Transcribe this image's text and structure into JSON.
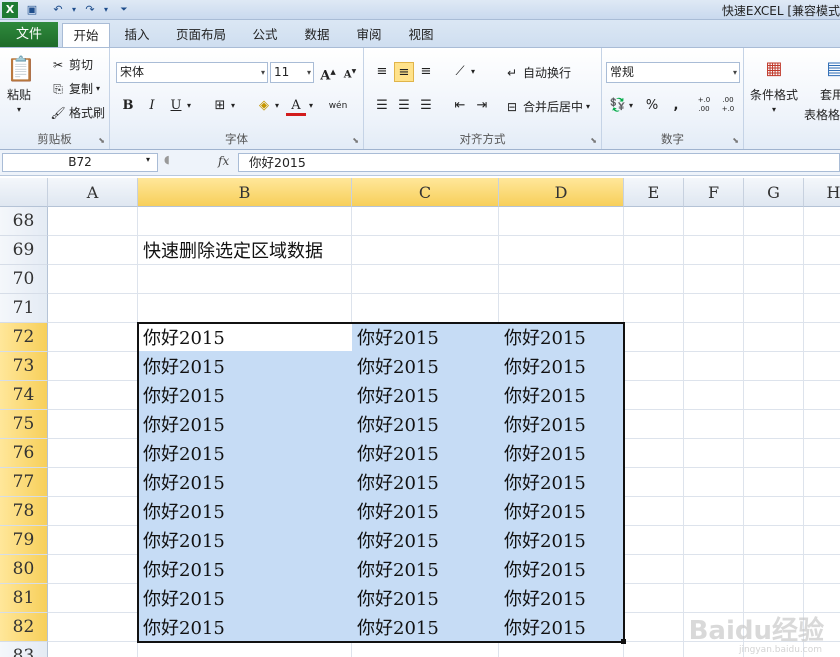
{
  "window": {
    "title": "快速EXCEL  [兼容模式"
  },
  "tabs": {
    "file": "文件",
    "items": [
      "开始",
      "插入",
      "页面布局",
      "公式",
      "数据",
      "审阅",
      "视图"
    ],
    "active": 0
  },
  "ribbon": {
    "clipboard": {
      "label": "剪贴板",
      "paste": "粘贴",
      "cut": "剪切",
      "copy": "复制",
      "format_painter": "格式刷"
    },
    "font": {
      "label": "字体",
      "font_name": "宋体",
      "font_size": "11",
      "bold": "B",
      "italic": "I",
      "underline": "U",
      "grow": "A",
      "shrink": "A",
      "color": "A",
      "phonetic": "wén"
    },
    "alignment": {
      "label": "对齐方式",
      "wrap_text": "自动换行",
      "merge_center": "合并后居中"
    },
    "number": {
      "label": "数字",
      "format": "常规",
      "percent": "%",
      "comma": ",",
      "inc_decimal": "+.0 .00",
      "dec_decimal": ".00 +.0"
    },
    "styles": {
      "conditional": "条件格式",
      "table_format_1": "套用",
      "table_format_2": "表格格"
    }
  },
  "formula_bar": {
    "name_box": "B72",
    "fx": "fx",
    "content": "你好2015"
  },
  "grid": {
    "columns": [
      "A",
      "B",
      "C",
      "D",
      "E",
      "F",
      "G",
      "H"
    ],
    "selected_columns": [
      "B",
      "C",
      "D"
    ],
    "rows": [
      "68",
      "69",
      "70",
      "71",
      "72",
      "73",
      "74",
      "75",
      "76",
      "77",
      "78",
      "79",
      "80",
      "81",
      "82",
      "83"
    ],
    "selected_rows": [
      "72",
      "73",
      "74",
      "75",
      "76",
      "77",
      "78",
      "79",
      "80",
      "81",
      "82"
    ],
    "title_cell": {
      "ref": "B69",
      "text": "快速删除选定区域数据"
    },
    "cell_value": "你好2015",
    "active_cell": "B72",
    "selection": "B72:D82"
  },
  "watermark": {
    "text": "Baidu经验",
    "sub": "jingyan.baidu.com"
  }
}
